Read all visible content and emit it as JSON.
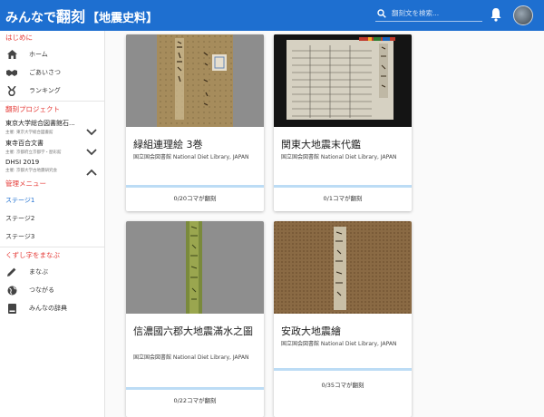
{
  "header": {
    "logo_part1": "みんなで",
    "logo_part2": "で",
    "logo_part3": "翻刻",
    "logo_part4": "【地震史料】",
    "search_placeholder": "翻刻文を検索..."
  },
  "sidebar": {
    "intro_title": "はじめに",
    "intro_items": [
      {
        "label": "ホーム",
        "icon": "home-icon"
      },
      {
        "label": "ごあいさつ",
        "icon": "handshake-icon"
      },
      {
        "label": "ランキング",
        "icon": "medal-icon"
      }
    ],
    "projects_title": "翻刻プロジェクト",
    "projects": [
      {
        "title": "東京大学総合図書館石...",
        "sub": "主催: 東京大学総合図書館",
        "chevron": "down"
      },
      {
        "title": "東寺百合文書",
        "sub": "主催: 京都府立京都学・歴彩館",
        "chevron": "down"
      },
      {
        "title": "DHSI 2019",
        "sub": "主催: 京都大学古地震研究会",
        "chevron": "up"
      }
    ],
    "admin_title": "管理メニュー",
    "stages": [
      "ステージ1",
      "ステージ2",
      "ステージ3"
    ],
    "learn_title": "くずし字をまなぶ",
    "learn_items": [
      {
        "label": "まなぶ",
        "icon": "pencil-icon"
      },
      {
        "label": "つながる",
        "icon": "globe-icon"
      },
      {
        "label": "みんなの辞典",
        "icon": "book-icon"
      }
    ]
  },
  "cards": [
    {
      "title": "緑組連理絵 3巻",
      "source": "国立国会図書館 National Diet Library, JAPAN",
      "progress": "0/20コマが翻刻"
    },
    {
      "title": "関東大地震末代鑑",
      "source": "国立国会図書館 National Diet Library, JAPAN",
      "progress": "0/1コマが翻刻"
    },
    {
      "title": "信濃國六郡大地震滿水之圖",
      "source": "国立国会図書館 National Diet Library, JAPAN",
      "progress": "0/22コマが翻刻"
    },
    {
      "title": "安政大地震繪",
      "source": "国立国会図書館 National Diet Library, JAPAN",
      "progress": "0/35コマが翻刻"
    }
  ],
  "colors": {
    "primary": "#1e6fd0",
    "accent_red": "#e53935",
    "progress_bar": "#bcdcf5"
  }
}
